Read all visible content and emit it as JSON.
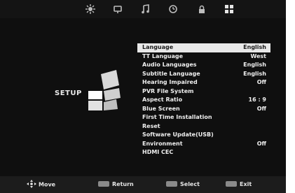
{
  "top_icons": [
    "picture-icon",
    "sound-icon",
    "music-icon",
    "clock-icon",
    "lock-icon",
    "setup-grid-icon"
  ],
  "title": "SETUP",
  "menu": [
    {
      "label": "Language",
      "value": "English"
    },
    {
      "label": "TT Language",
      "value": "West"
    },
    {
      "label": "Audio Languages",
      "value": "English"
    },
    {
      "label": "Subtitle Language",
      "value": "English"
    },
    {
      "label": "Hearing Impaired",
      "value": "Off"
    },
    {
      "label": "PVR File System",
      "value": ""
    },
    {
      "label": "Aspect Ratio",
      "value": "16 : 9"
    },
    {
      "label": "Blue Screen",
      "value": "Off"
    },
    {
      "label": "First Time Installation",
      "value": ""
    },
    {
      "label": "Reset",
      "value": ""
    },
    {
      "label": "Software Update(USB)",
      "value": ""
    },
    {
      "label": "Environment",
      "value": "Off"
    },
    {
      "label": "HDMI CEC",
      "value": ""
    }
  ],
  "selected_index": 0,
  "footer": {
    "move": "Move",
    "return": "Return",
    "select": "Select",
    "exit": "Exit"
  },
  "colors": {
    "background": "#0f0f0f",
    "highlight": "#e8e8e8",
    "text": "#f0f0f0",
    "footer": "#1c1c1c"
  }
}
